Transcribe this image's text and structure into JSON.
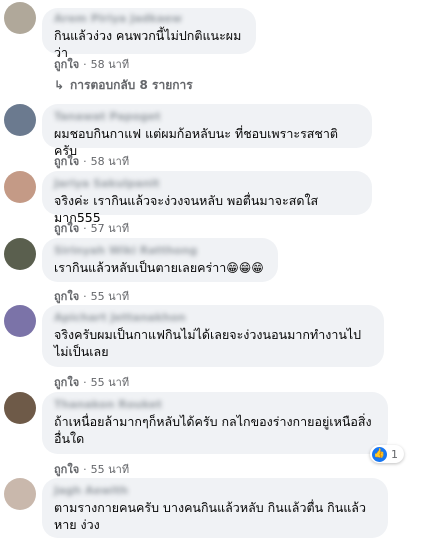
{
  "comments": [
    {
      "name": "Arem Piriya Jadkaew",
      "text": "กินแล้วง่วง คนพวกนี้ไม่ปกติแนะผมว่า",
      "like": "ถูกใจ",
      "time": "58 นาที"
    },
    {
      "name": "Tanawat Papoget",
      "text": "ผมชอบกินกาแฟ แต่ผมก้อหลับนะ ที่ชอบเพราะรสชาติครับ",
      "like": "ถูกใจ",
      "time": "58 นาที"
    },
    {
      "name": "Jariya Sakulpanit",
      "text": "จริงค่ะ เรากินแล้วจะง่วงจนหลับ พอตื่นมาจะสดใสมาก555",
      "like": "ถูกใจ",
      "time": "57 นาที"
    },
    {
      "name": "Sirinyah Wiki Ratthong",
      "text": "เรากินแล้วหลับเป็นตายเลยคร่าา",
      "emoji": "😁😁😁",
      "like": "ถูกใจ",
      "time": "55 นาที"
    },
    {
      "name": "Apichart Jettanakhon",
      "text": "จริงครับผมเป็นกาแฟกินไม่ได้เลยจะง่วงนอนมากทำงานไปไม่เป็นเลย",
      "like": "ถูกใจ",
      "time": "55 นาที"
    },
    {
      "name": "Thanakon Rouket",
      "text": "ถ้าเหนื่อยล้ามากๆก็หลับได้ครับ กลไกของร่างกายอยู่เหนือสิ่งอื่นใด",
      "like": "ถูกใจ",
      "time": "55 นาที",
      "reaction_count": "1"
    },
    {
      "name": "Jagh Aewith",
      "text": "ตามรางกายคนครับ บางคนกินแล้วหลับ กินแล้วตื่น กินแล้วหาย ง่วง",
      "like": "ถูกใจ",
      "time": ""
    }
  ],
  "replies_label": "การตอบกลับ 8 รายการ",
  "colors": {
    "bubble": "#f0f2f5",
    "meta": "#65676b",
    "like_blue": "#1877f2"
  }
}
